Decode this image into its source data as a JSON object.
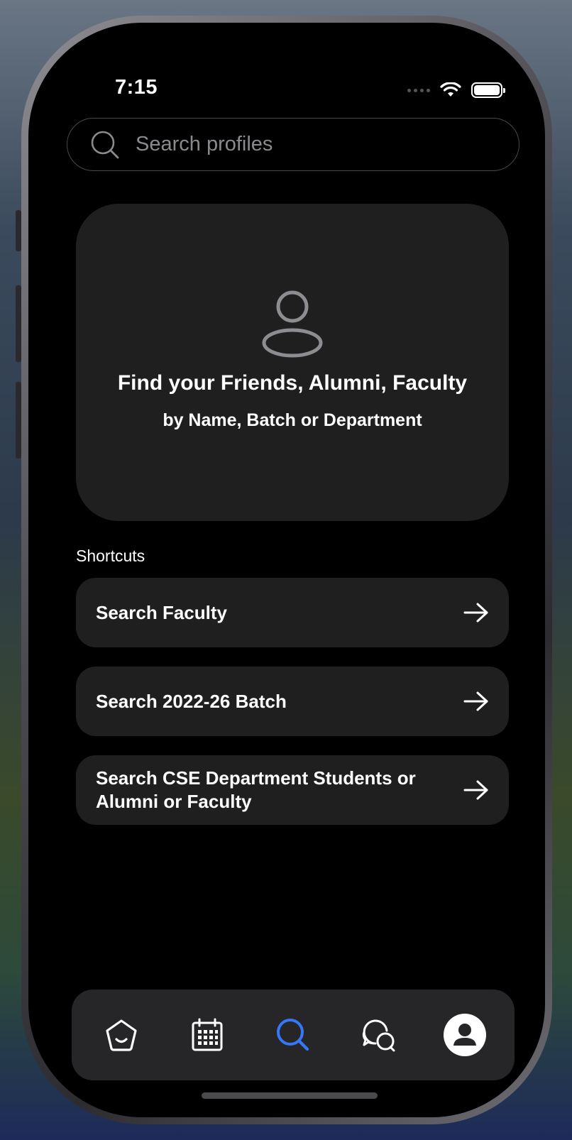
{
  "status_bar": {
    "time": "7:15"
  },
  "search": {
    "placeholder": "Search profiles",
    "value": ""
  },
  "hero": {
    "icon": "person-outline-icon",
    "title": "Find your Friends, Alumni, Faculty",
    "subtitle": "by Name, Batch or Department"
  },
  "shortcuts": {
    "heading": "Shortcuts",
    "items": [
      {
        "label": "Search Faculty",
        "icon": "arrow-right-icon"
      },
      {
        "label": "Search 2022-26 Batch",
        "icon": "arrow-right-icon"
      },
      {
        "label": "Search CSE Department Students or Alumni or Faculty",
        "icon": "arrow-right-icon"
      }
    ]
  },
  "tab_bar": {
    "active_color": "#3478f6",
    "tabs": [
      {
        "name": "home",
        "icon": "home-icon"
      },
      {
        "name": "calendar",
        "icon": "calendar-icon"
      },
      {
        "name": "search",
        "icon": "search-icon",
        "active": true
      },
      {
        "name": "chat",
        "icon": "chat-bubbles-icon"
      },
      {
        "name": "profile",
        "icon": "profile-avatar-icon"
      }
    ]
  }
}
